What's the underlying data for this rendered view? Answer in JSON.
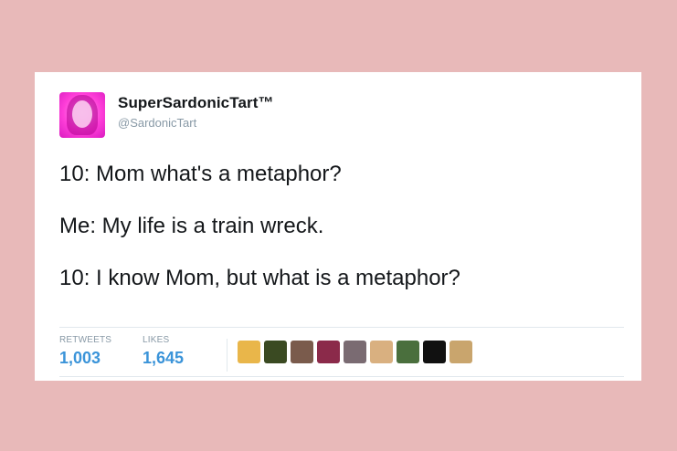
{
  "tweet": {
    "display_name": "SuperSardonicTart™",
    "handle": "@SardonicTart",
    "lines": [
      "10: Mom what's a metaphor?",
      "Me: My life is a train wreck.",
      "10: I know Mom, but what is a metaphor?"
    ],
    "stats": {
      "retweets_label": "RETWEETS",
      "retweets": "1,003",
      "likes_label": "LIKES",
      "likes": "1,645"
    },
    "likers": [
      {
        "color": "#e9b64a"
      },
      {
        "color": "#3a4a22"
      },
      {
        "color": "#7a5b4c"
      },
      {
        "color": "#8b2a4a"
      },
      {
        "color": "#7a6b72"
      },
      {
        "color": "#d9b080"
      },
      {
        "color": "#4a6f3d"
      },
      {
        "color": "#111111"
      },
      {
        "color": "#c9a56d"
      }
    ]
  }
}
